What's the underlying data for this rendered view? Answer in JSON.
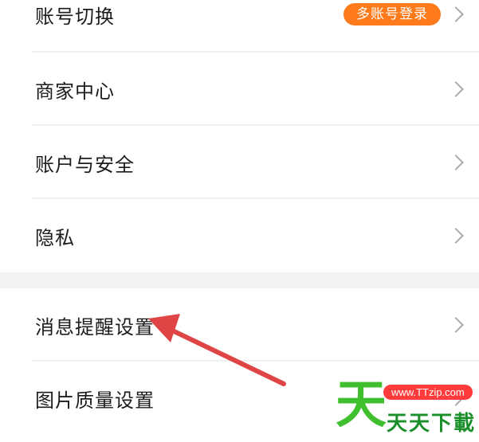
{
  "settings": {
    "items": [
      {
        "label": "账号切换",
        "badge": "多账号登录"
      },
      {
        "label": "商家中心"
      },
      {
        "label": "账户与安全"
      },
      {
        "label": "隐私"
      },
      {
        "label": "消息提醒设置"
      },
      {
        "label": "图片质量设置"
      }
    ]
  },
  "colors": {
    "badge": "#ff7a1a",
    "arrow": "#e04545",
    "chevron": "#a9a9a9"
  },
  "watermark": {
    "logo_char": "天",
    "url": "www.TTzip.com",
    "name": "天天下載"
  }
}
